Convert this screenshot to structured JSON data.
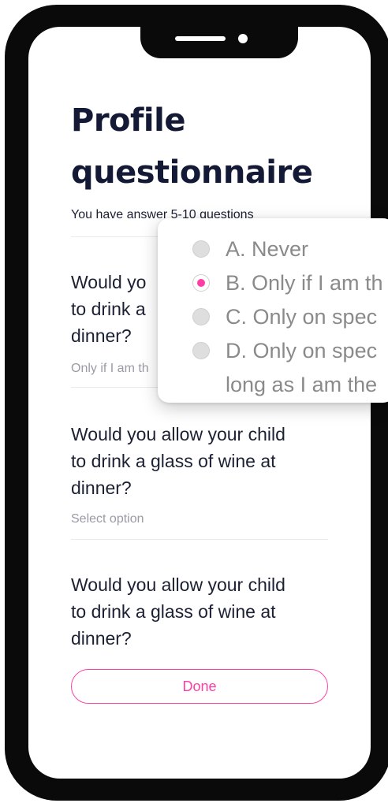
{
  "page": {
    "title_line1": "Profile",
    "title_line2": "questionnaire",
    "subtitle": "You have answer 5-10 questions"
  },
  "questions": [
    {
      "text": "Would you allow your child to drink a glass of wine at dinner?",
      "visible_text": "Would yo",
      "visible_line2": "to drink a",
      "visible_line3": "dinner?",
      "answer": "Only if I am th"
    },
    {
      "line1": "Would you allow your child",
      "line2": "to drink a glass of wine at",
      "line3": "dinner?",
      "answer": "Select option"
    },
    {
      "line1": "Would you allow your child",
      "line2": "to drink a glass of wine at",
      "line3": "dinner?"
    }
  ],
  "done_button": {
    "label": "Done"
  },
  "popup": {
    "options": [
      {
        "label": "A. Never",
        "selected": false
      },
      {
        "label": "B. Only if I am th",
        "selected": true
      },
      {
        "label": "C. Only on spec",
        "selected": false
      },
      {
        "label": "D. Only on spec",
        "label_line2": "long as I am the",
        "selected": false
      }
    ]
  },
  "colors": {
    "accent": "#ff3ea5",
    "text": "#1c2033",
    "muted": "#9a9aa6"
  }
}
